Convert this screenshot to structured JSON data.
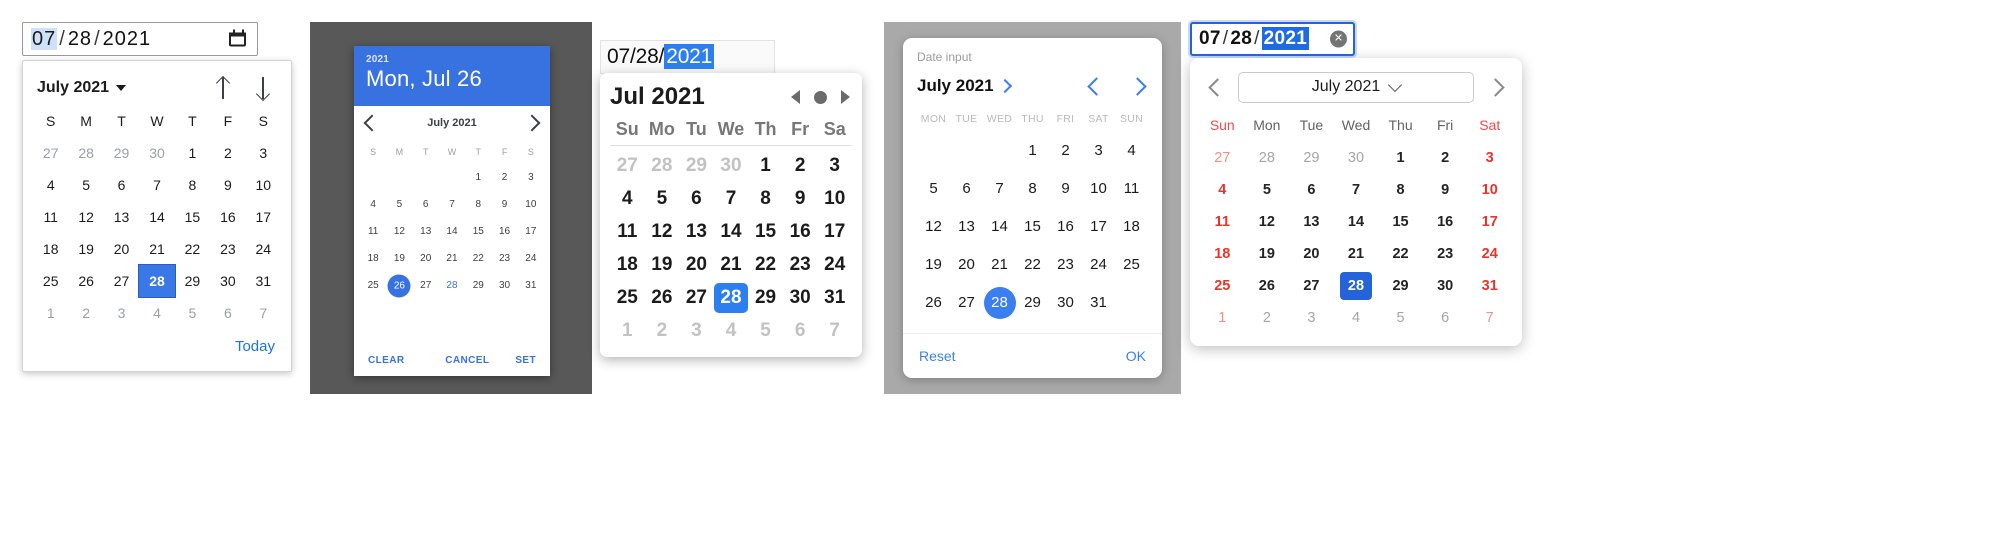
{
  "picker1": {
    "name": "chrome-date-input",
    "input": {
      "month": "07",
      "day": "28",
      "year": "2021",
      "sep": "/",
      "selected_segment": "month"
    },
    "icon": "calendar-icon",
    "header": {
      "month_label": "July 2021",
      "caret": "chevron-down-icon",
      "up": "arrow-up-icon",
      "down": "arrow-down-icon"
    },
    "weekdays": [
      "S",
      "M",
      "T",
      "W",
      "T",
      "F",
      "S"
    ],
    "weeks": [
      [
        {
          "n": "27",
          "mut": true
        },
        {
          "n": "28",
          "mut": true
        },
        {
          "n": "29",
          "mut": true
        },
        {
          "n": "30",
          "mut": true
        },
        {
          "n": "1"
        },
        {
          "n": "2"
        },
        {
          "n": "3"
        }
      ],
      [
        {
          "n": "4"
        },
        {
          "n": "5"
        },
        {
          "n": "6"
        },
        {
          "n": "7"
        },
        {
          "n": "8"
        },
        {
          "n": "9"
        },
        {
          "n": "10"
        }
      ],
      [
        {
          "n": "11"
        },
        {
          "n": "12"
        },
        {
          "n": "13"
        },
        {
          "n": "14"
        },
        {
          "n": "15"
        },
        {
          "n": "16"
        },
        {
          "n": "17"
        }
      ],
      [
        {
          "n": "18"
        },
        {
          "n": "19"
        },
        {
          "n": "20"
        },
        {
          "n": "21"
        },
        {
          "n": "22"
        },
        {
          "n": "23"
        },
        {
          "n": "24"
        }
      ],
      [
        {
          "n": "25"
        },
        {
          "n": "26"
        },
        {
          "n": "27"
        },
        {
          "n": "28",
          "sel": true
        },
        {
          "n": "29"
        },
        {
          "n": "30"
        },
        {
          "n": "31"
        }
      ],
      [
        {
          "n": "1",
          "mut": true
        },
        {
          "n": "2",
          "mut": true
        },
        {
          "n": "3",
          "mut": true
        },
        {
          "n": "4",
          "mut": true
        },
        {
          "n": "5",
          "mut": true
        },
        {
          "n": "6",
          "mut": true
        },
        {
          "n": "7",
          "mut": true
        }
      ]
    ],
    "today_label": "Today",
    "accent": "#3b78e7"
  },
  "picker2": {
    "name": "material-date-dialog",
    "header": {
      "year": "2021",
      "date_line": "Mon, Jul 26"
    },
    "nav": {
      "prev": "chevron-left-icon",
      "month_label": "July 2021",
      "next": "chevron-right-icon"
    },
    "weekdays": [
      "S",
      "M",
      "T",
      "W",
      "T",
      "F",
      "S"
    ],
    "weeks": [
      [
        {
          "n": ""
        },
        {
          "n": ""
        },
        {
          "n": ""
        },
        {
          "n": ""
        },
        {
          "n": "1"
        },
        {
          "n": "2"
        },
        {
          "n": "3"
        }
      ],
      [
        {
          "n": "4"
        },
        {
          "n": "5"
        },
        {
          "n": "6"
        },
        {
          "n": "7"
        },
        {
          "n": "8"
        },
        {
          "n": "9"
        },
        {
          "n": "10"
        }
      ],
      [
        {
          "n": "11"
        },
        {
          "n": "12"
        },
        {
          "n": "13"
        },
        {
          "n": "14"
        },
        {
          "n": "15"
        },
        {
          "n": "16"
        },
        {
          "n": "17"
        }
      ],
      [
        {
          "n": "18"
        },
        {
          "n": "19"
        },
        {
          "n": "20"
        },
        {
          "n": "21"
        },
        {
          "n": "22"
        },
        {
          "n": "23"
        },
        {
          "n": "24"
        }
      ],
      [
        {
          "n": "25"
        },
        {
          "n": "26",
          "sel": true
        },
        {
          "n": "27"
        },
        {
          "n": "28",
          "today": true
        },
        {
          "n": "29"
        },
        {
          "n": "30"
        },
        {
          "n": "31"
        }
      ]
    ],
    "actions": {
      "clear": "CLEAR",
      "cancel": "CANCEL",
      "set": "SET"
    },
    "accent": "#3871e0",
    "scrim": "#585858"
  },
  "picker3": {
    "name": "macos-date-picker",
    "input": {
      "month": "07",
      "day": "28",
      "year": "2021",
      "sep": "/",
      "selected_segment": "year"
    },
    "header": {
      "month_label": "Jul 2021",
      "prev": "triangle-left-icon",
      "stop": "circle-icon",
      "next": "triangle-right-icon"
    },
    "weekdays": [
      "Su",
      "Mo",
      "Tu",
      "We",
      "Th",
      "Fr",
      "Sa"
    ],
    "weeks": [
      [
        {
          "n": "27",
          "mut": true
        },
        {
          "n": "28",
          "mut": true
        },
        {
          "n": "29",
          "mut": true
        },
        {
          "n": "30",
          "mut": true
        },
        {
          "n": "1"
        },
        {
          "n": "2"
        },
        {
          "n": "3"
        }
      ],
      [
        {
          "n": "4"
        },
        {
          "n": "5"
        },
        {
          "n": "6"
        },
        {
          "n": "7"
        },
        {
          "n": "8"
        },
        {
          "n": "9"
        },
        {
          "n": "10"
        }
      ],
      [
        {
          "n": "11"
        },
        {
          "n": "12"
        },
        {
          "n": "13"
        },
        {
          "n": "14"
        },
        {
          "n": "15"
        },
        {
          "n": "16"
        },
        {
          "n": "17"
        }
      ],
      [
        {
          "n": "18"
        },
        {
          "n": "19"
        },
        {
          "n": "20"
        },
        {
          "n": "21"
        },
        {
          "n": "22"
        },
        {
          "n": "23"
        },
        {
          "n": "24"
        }
      ],
      [
        {
          "n": "25"
        },
        {
          "n": "26"
        },
        {
          "n": "27"
        },
        {
          "n": "28",
          "sel": true
        },
        {
          "n": "29"
        },
        {
          "n": "30"
        },
        {
          "n": "31"
        }
      ],
      [
        {
          "n": "1",
          "mut": true
        },
        {
          "n": "2",
          "mut": true
        },
        {
          "n": "3",
          "mut": true
        },
        {
          "n": "4",
          "mut": true
        },
        {
          "n": "5",
          "mut": true
        },
        {
          "n": "6",
          "mut": true
        },
        {
          "n": "7",
          "mut": true
        }
      ]
    ],
    "accent": "#2d7ff0"
  },
  "picker4": {
    "name": "ios-date-picker",
    "label": "Date input",
    "nav": {
      "month_label": "July 2021",
      "month_chevron": "chevron-right-icon",
      "prev": "chevron-left-icon",
      "next": "chevron-right-icon"
    },
    "weekdays": [
      "MON",
      "TUE",
      "WED",
      "THU",
      "FRI",
      "SAT",
      "SUN"
    ],
    "weeks": [
      [
        {
          "n": ""
        },
        {
          "n": ""
        },
        {
          "n": ""
        },
        {
          "n": "1"
        },
        {
          "n": "2"
        },
        {
          "n": "3"
        },
        {
          "n": "4"
        }
      ],
      [
        {
          "n": "5"
        },
        {
          "n": "6"
        },
        {
          "n": "7"
        },
        {
          "n": "8"
        },
        {
          "n": "9"
        },
        {
          "n": "10"
        },
        {
          "n": "11"
        }
      ],
      [
        {
          "n": "12"
        },
        {
          "n": "13"
        },
        {
          "n": "14"
        },
        {
          "n": "15"
        },
        {
          "n": "16"
        },
        {
          "n": "17"
        },
        {
          "n": "18"
        }
      ],
      [
        {
          "n": "19"
        },
        {
          "n": "20"
        },
        {
          "n": "21"
        },
        {
          "n": "22"
        },
        {
          "n": "23"
        },
        {
          "n": "24"
        },
        {
          "n": "25"
        }
      ],
      [
        {
          "n": "26"
        },
        {
          "n": "27"
        },
        {
          "n": "28",
          "sel": true
        },
        {
          "n": "29"
        },
        {
          "n": "30"
        },
        {
          "n": "31"
        },
        {
          "n": ""
        }
      ]
    ],
    "actions": {
      "reset": "Reset",
      "ok": "OK"
    },
    "accent": "#3b7ef0",
    "scrim": "#a9a9a9"
  },
  "picker5": {
    "name": "edge-date-picker",
    "input": {
      "month": "07",
      "day": "28",
      "year": "2021",
      "sep": "/",
      "selected_segment": "year",
      "clear_icon": "clear-circle-icon",
      "clear_glyph": "✕"
    },
    "header": {
      "prev": "chevron-left-icon",
      "month_label": "July 2021",
      "dropdown_icon": "chevron-down-icon",
      "next": "chevron-right-icon"
    },
    "weekdays": [
      "Sun",
      "Mon",
      "Tue",
      "Wed",
      "Thu",
      "Fri",
      "Sat"
    ],
    "weeks": [
      [
        {
          "n": "27",
          "mut": true,
          "we": true
        },
        {
          "n": "28",
          "mut": true
        },
        {
          "n": "29",
          "mut": true
        },
        {
          "n": "30",
          "mut": true
        },
        {
          "n": "1"
        },
        {
          "n": "2"
        },
        {
          "n": "3",
          "we": true
        }
      ],
      [
        {
          "n": "4",
          "we": true
        },
        {
          "n": "5"
        },
        {
          "n": "6"
        },
        {
          "n": "7"
        },
        {
          "n": "8"
        },
        {
          "n": "9"
        },
        {
          "n": "10",
          "we": true
        }
      ],
      [
        {
          "n": "11",
          "we": true
        },
        {
          "n": "12"
        },
        {
          "n": "13"
        },
        {
          "n": "14"
        },
        {
          "n": "15"
        },
        {
          "n": "16"
        },
        {
          "n": "17",
          "we": true
        }
      ],
      [
        {
          "n": "18",
          "we": true
        },
        {
          "n": "19"
        },
        {
          "n": "20"
        },
        {
          "n": "21"
        },
        {
          "n": "22"
        },
        {
          "n": "23"
        },
        {
          "n": "24",
          "we": true
        }
      ],
      [
        {
          "n": "25",
          "we": true
        },
        {
          "n": "26"
        },
        {
          "n": "27"
        },
        {
          "n": "28",
          "sel": true
        },
        {
          "n": "29"
        },
        {
          "n": "30"
        },
        {
          "n": "31",
          "we": true
        }
      ],
      [
        {
          "n": "1",
          "mut": true,
          "we": true
        },
        {
          "n": "2",
          "mut": true
        },
        {
          "n": "3",
          "mut": true
        },
        {
          "n": "4",
          "mut": true
        },
        {
          "n": "5",
          "mut": true
        },
        {
          "n": "6",
          "mut": true
        },
        {
          "n": "7",
          "mut": true,
          "we": true
        }
      ]
    ],
    "accent": "#2563d8",
    "weekend_color": "#e8342a"
  }
}
